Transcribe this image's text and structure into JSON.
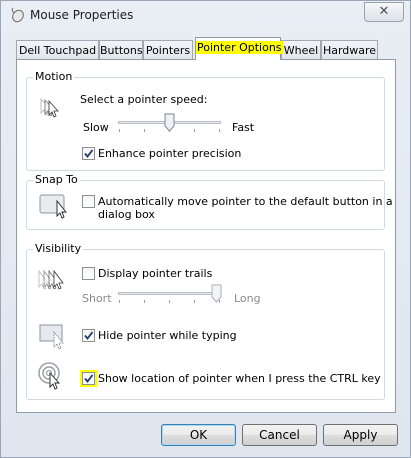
{
  "window": {
    "title": "Mouse Properties",
    "close_glyph": "✕"
  },
  "tabs": [
    {
      "label": "Dell Touchpad"
    },
    {
      "label": "Buttons"
    },
    {
      "label": "Pointers"
    },
    {
      "label": "Pointer Options",
      "active": true
    },
    {
      "label": "Wheel"
    },
    {
      "label": "Hardware"
    }
  ],
  "motion": {
    "group_label": "Motion",
    "speed_label": "Select a pointer speed:",
    "slow_label": "Slow",
    "fast_label": "Fast",
    "speed_value": 0.5,
    "enhance_label": "Enhance pointer precision",
    "enhance_checked": true,
    "icon": "pointer-speed-icon"
  },
  "snap": {
    "group_label": "Snap To",
    "auto_move_label_line1": "Automatically move pointer to the default button in a",
    "auto_move_label_line2": "dialog box",
    "auto_move_checked": false,
    "icon": "snap-to-icon"
  },
  "visibility": {
    "group_label": "Visibility",
    "trails_label": "Display pointer trails",
    "trails_checked": false,
    "short_label": "Short",
    "long_label": "Long",
    "trails_value": 1.0,
    "hide_label": "Hide pointer while typing",
    "hide_checked": true,
    "show_location_label": "Show location of pointer when I press the CTRL key",
    "show_location_checked": true,
    "icons": [
      "pointer-trails-icon",
      "hide-pointer-icon",
      "locate-pointer-icon"
    ]
  },
  "buttons": {
    "ok": "OK",
    "cancel": "Cancel",
    "apply": "Apply"
  },
  "colors": {
    "highlight": "#ffff00",
    "panel": "#ffffff",
    "window": "#e4eaf2"
  }
}
